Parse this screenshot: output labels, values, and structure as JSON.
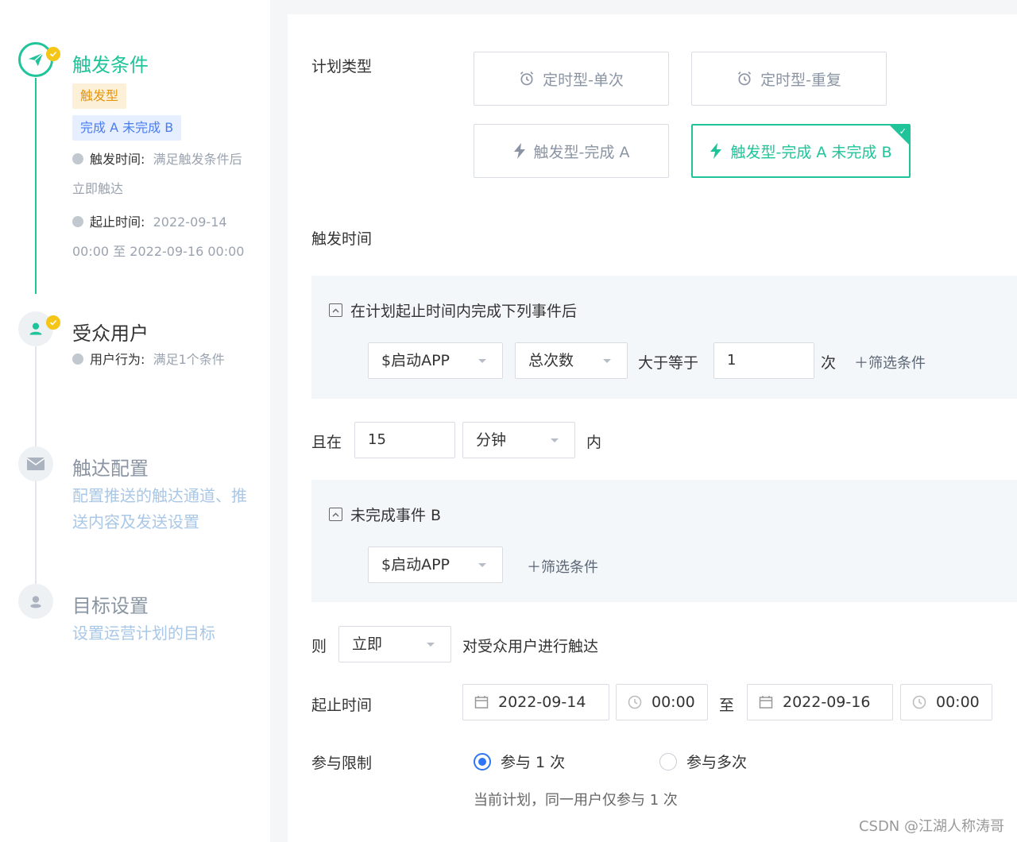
{
  "steps": {
    "s1": {
      "title": "触发条件",
      "tag_type": "触发型",
      "tag_rule": "完成 A 未完成 B",
      "trigger_time_label": "触发时间:",
      "trigger_time_value_a": "满足触发条件后",
      "trigger_time_value_b": "立即触达",
      "range_label": "起止时间:",
      "range_value_a": "2022-09-14",
      "range_value_b": "00:00 至 2022-09-16 00:00"
    },
    "s2": {
      "title": "受众用户",
      "behavior_label": "用户行为:",
      "behavior_value": "满足1个条件"
    },
    "s3": {
      "title": "触达配置",
      "desc_a": "配置推送的触达通道、推",
      "desc_b": "送内容及发送设置"
    },
    "s4": {
      "title": "目标设置",
      "desc": "设置运营计划的目标"
    }
  },
  "form": {
    "plan_type_label": "计划类型",
    "types": [
      "定时型-单次",
      "定时型-重复",
      "触发型-完成 A",
      "触发型-完成 A 未完成 B"
    ],
    "trigger_time_label": "触发时间",
    "complete_header": "在计划起止时间内完成下列事件后",
    "event_a": "$启动APP",
    "metric": "总次数",
    "compare": "大于等于",
    "count_value": "1",
    "count_unit": "次",
    "add_filter": "筛选条件",
    "within_prefix": "且在",
    "within_value": "15",
    "within_unit": "分钟",
    "within_suffix": "内",
    "not_complete_header": "未完成事件 B",
    "event_b": "$启动APP",
    "then_prefix": "则",
    "then_select": "立即",
    "then_suffix": "对受众用户进行触达",
    "range_label": "起止时间",
    "start_date": "2022-09-14",
    "start_time": "00:00",
    "range_to": "至",
    "end_date": "2022-09-16",
    "end_time": "00:00",
    "limit_label": "参与限制",
    "limit_once": "参与 1 次",
    "limit_multi": "参与多次",
    "limit_hint": "当前计划，同一用户仅参与 1 次"
  },
  "watermark": "CSDN @江湖人称涛哥",
  "colors": {
    "accent": "#1fc49a",
    "radio": "#2f76f4",
    "badge": "#f5c518"
  },
  "icons": [
    "paper-plane-icon",
    "user-icon",
    "mail-icon",
    "target-pin-icon",
    "alarm-clock-icon",
    "lightning-icon",
    "calendar-icon",
    "clock-icon"
  ]
}
